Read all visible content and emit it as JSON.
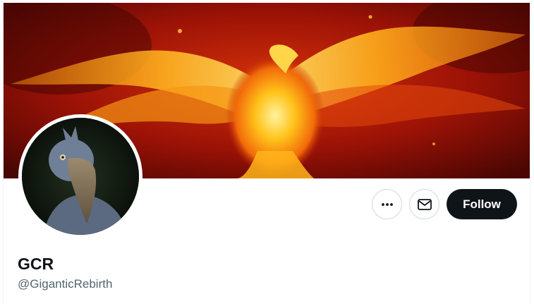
{
  "profile": {
    "display_name": "GCR",
    "handle": "@GiganticRebirth",
    "banner_subject": "flaming phoenix on red background",
    "avatar_subject": "shoebill bird"
  },
  "actions": {
    "more_icon": "more-horizontal-icon",
    "message_icon": "envelope-icon",
    "follow_label": "Follow"
  },
  "colors": {
    "follow_bg": "#0f1419",
    "follow_text": "#ffffff",
    "name_text": "#0f1419",
    "handle_text": "#536471",
    "banner_red": "#8a0c06",
    "banner_fire": "#ffb200"
  }
}
